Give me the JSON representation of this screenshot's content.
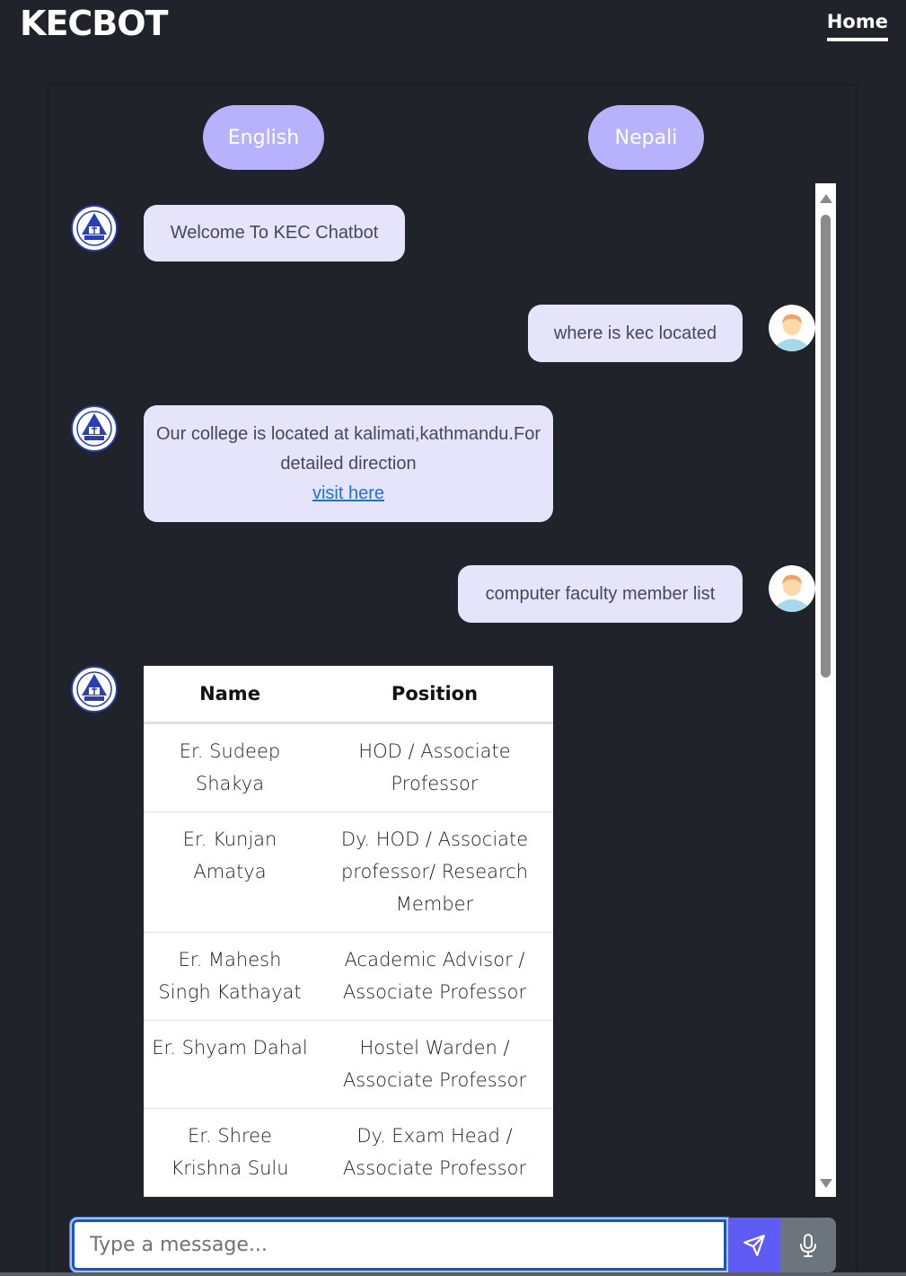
{
  "navbar": {
    "brand": "KECBOT",
    "home": "Home"
  },
  "languages": {
    "english": "English",
    "nepali": "Nepali"
  },
  "messages": [
    {
      "sender": "bot",
      "text": "Welcome To KEC Chatbot"
    },
    {
      "sender": "user",
      "text": "where is kec located"
    },
    {
      "sender": "bot",
      "text": "Our college is located at kalimati,kathmandu.For detailed direction",
      "link_text": "visit here"
    },
    {
      "sender": "user",
      "text": "computer faculty member list"
    }
  ],
  "faculty_table": {
    "headers": [
      "Name",
      "Position"
    ],
    "rows": [
      [
        "Er. Sudeep Shakya",
        "HOD / Associate Professor"
      ],
      [
        "Er. Kunjan Amatya",
        "Dy. HOD / Associate professor/ Research Member"
      ],
      [
        "Er. Mahesh Singh Kathayat",
        "Academic Advisor / Associate Professor"
      ],
      [
        "Er. Shyam Dahal",
        "Hostel Warden / Associate Professor"
      ],
      [
        "Er. Shree Krishna Sulu",
        "Dy. Exam Head / Associate Professor"
      ]
    ]
  },
  "composer": {
    "placeholder": "Type a message..."
  },
  "icons": {
    "bot": "college-logo-icon",
    "user": "user-avatar-icon",
    "send": "send-icon",
    "mic": "microphone-icon"
  },
  "colors": {
    "accent": "#b7b2fb",
    "bubble": "#e6e4fb",
    "send": "#5f5cf6",
    "background": "#202329"
  }
}
